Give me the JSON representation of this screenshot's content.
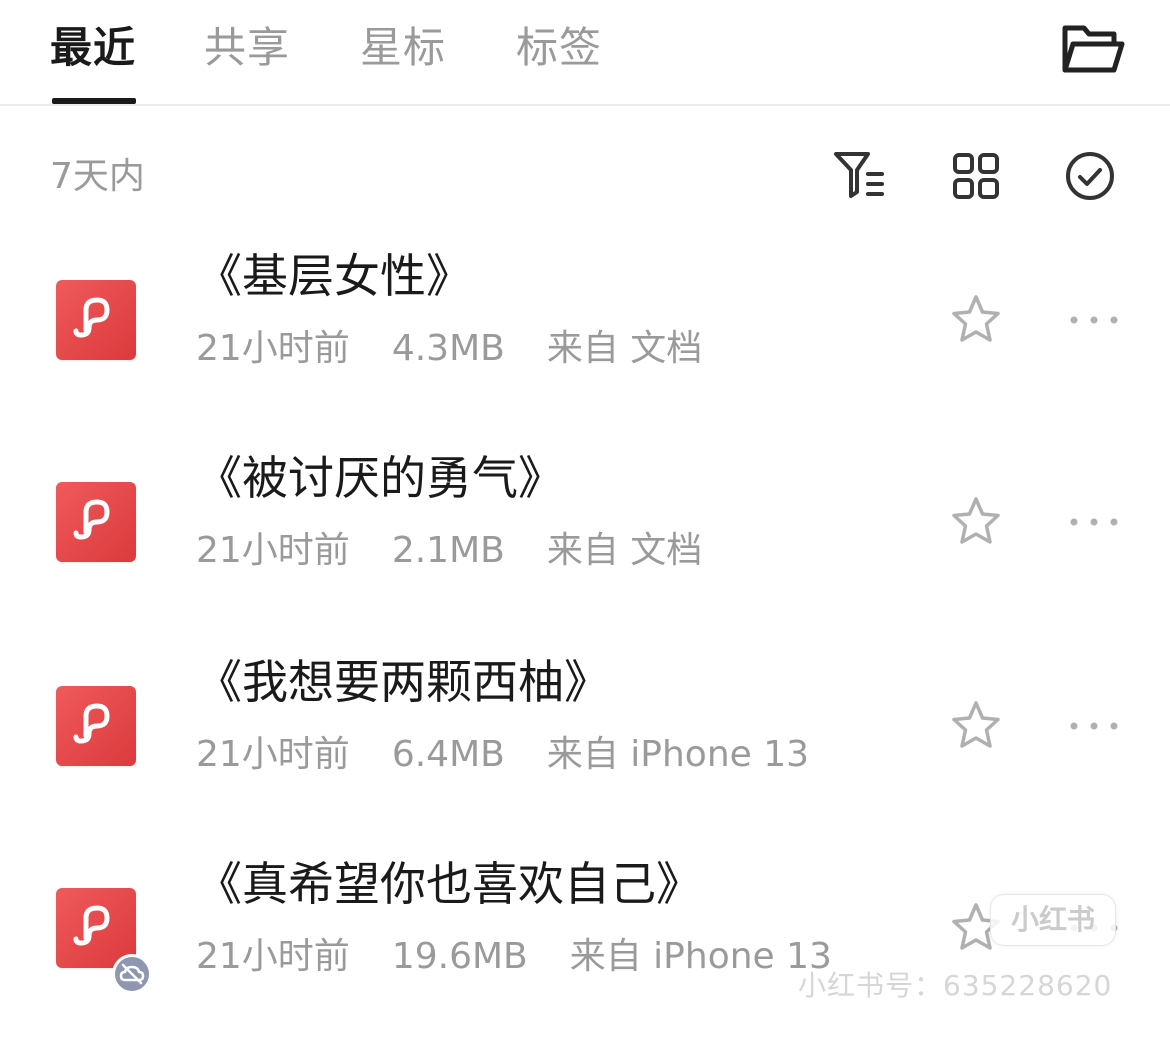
{
  "tabs": [
    {
      "label": "最近",
      "active": true
    },
    {
      "label": "共享",
      "active": false
    },
    {
      "label": "星标",
      "active": false
    },
    {
      "label": "标签",
      "active": false
    }
  ],
  "section": {
    "label": "7天内"
  },
  "icons": {
    "folder": "folder-icon",
    "filter": "filter-list-icon",
    "grid": "grid-view-icon",
    "select": "check-circle-icon",
    "file": "pdf-file-icon",
    "star": "star-outline-icon",
    "more": "more-horizontal-icon",
    "badge": "cloud-off-icon"
  },
  "colors": {
    "file_icon": "#e24a4c",
    "text_primary": "#1a1a1a",
    "text_secondary": "#9a9a9a",
    "badge": "#8e96b0"
  },
  "files": [
    {
      "title": "《基层女性》",
      "time": "21小时前",
      "size": "4.3MB",
      "source": "来自 文档"
    },
    {
      "title": "《被讨厌的勇气》",
      "time": "21小时前",
      "size": "2.1MB",
      "source": "来自 文档"
    },
    {
      "title": "《我想要两颗西柚》",
      "time": "21小时前",
      "size": "6.4MB",
      "source": "来自 iPhone 13"
    },
    {
      "title": "《真希望你也喜欢自己》",
      "time": "21小时前",
      "size": "19.6MB",
      "source": "来自 iPhone 13"
    }
  ],
  "watermark": {
    "brand": "小红书",
    "id": "小红书号：635228620"
  }
}
